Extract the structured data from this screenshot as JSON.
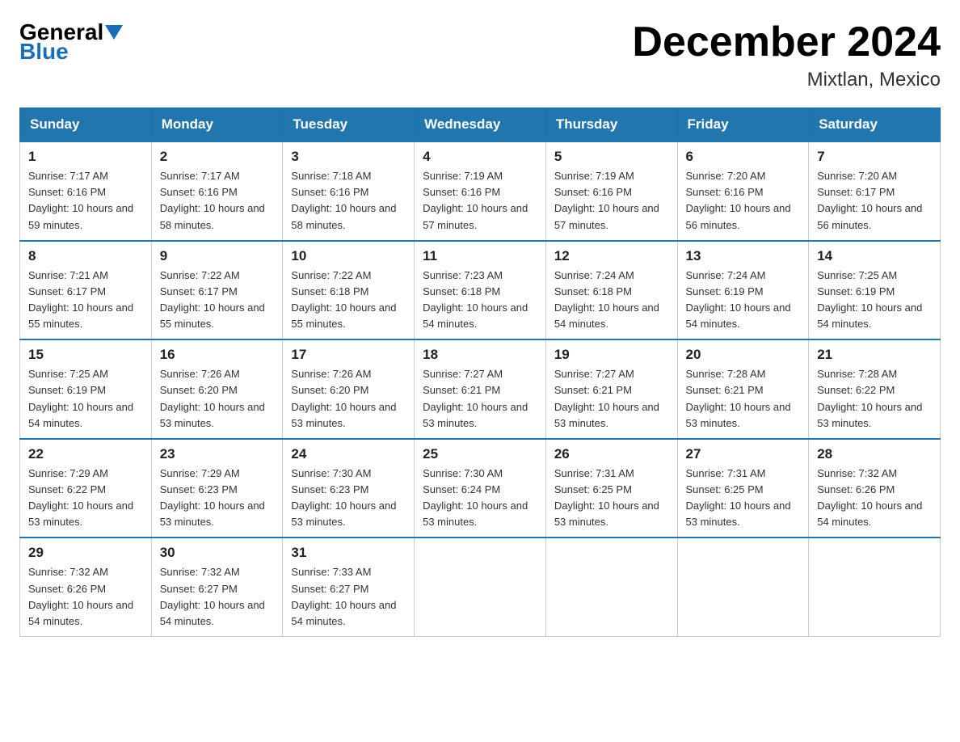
{
  "logo": {
    "general": "General",
    "blue": "Blue"
  },
  "header": {
    "title": "December 2024",
    "location": "Mixtlan, Mexico"
  },
  "days_of_week": [
    "Sunday",
    "Monday",
    "Tuesday",
    "Wednesday",
    "Thursday",
    "Friday",
    "Saturday"
  ],
  "weeks": [
    [
      {
        "day": "1",
        "sunrise": "7:17 AM",
        "sunset": "6:16 PM",
        "daylight": "10 hours and 59 minutes."
      },
      {
        "day": "2",
        "sunrise": "7:17 AM",
        "sunset": "6:16 PM",
        "daylight": "10 hours and 58 minutes."
      },
      {
        "day": "3",
        "sunrise": "7:18 AM",
        "sunset": "6:16 PM",
        "daylight": "10 hours and 58 minutes."
      },
      {
        "day": "4",
        "sunrise": "7:19 AM",
        "sunset": "6:16 PM",
        "daylight": "10 hours and 57 minutes."
      },
      {
        "day": "5",
        "sunrise": "7:19 AM",
        "sunset": "6:16 PM",
        "daylight": "10 hours and 57 minutes."
      },
      {
        "day": "6",
        "sunrise": "7:20 AM",
        "sunset": "6:16 PM",
        "daylight": "10 hours and 56 minutes."
      },
      {
        "day": "7",
        "sunrise": "7:20 AM",
        "sunset": "6:17 PM",
        "daylight": "10 hours and 56 minutes."
      }
    ],
    [
      {
        "day": "8",
        "sunrise": "7:21 AM",
        "sunset": "6:17 PM",
        "daylight": "10 hours and 55 minutes."
      },
      {
        "day": "9",
        "sunrise": "7:22 AM",
        "sunset": "6:17 PM",
        "daylight": "10 hours and 55 minutes."
      },
      {
        "day": "10",
        "sunrise": "7:22 AM",
        "sunset": "6:18 PM",
        "daylight": "10 hours and 55 minutes."
      },
      {
        "day": "11",
        "sunrise": "7:23 AM",
        "sunset": "6:18 PM",
        "daylight": "10 hours and 54 minutes."
      },
      {
        "day": "12",
        "sunrise": "7:24 AM",
        "sunset": "6:18 PM",
        "daylight": "10 hours and 54 minutes."
      },
      {
        "day": "13",
        "sunrise": "7:24 AM",
        "sunset": "6:19 PM",
        "daylight": "10 hours and 54 minutes."
      },
      {
        "day": "14",
        "sunrise": "7:25 AM",
        "sunset": "6:19 PM",
        "daylight": "10 hours and 54 minutes."
      }
    ],
    [
      {
        "day": "15",
        "sunrise": "7:25 AM",
        "sunset": "6:19 PM",
        "daylight": "10 hours and 54 minutes."
      },
      {
        "day": "16",
        "sunrise": "7:26 AM",
        "sunset": "6:20 PM",
        "daylight": "10 hours and 53 minutes."
      },
      {
        "day": "17",
        "sunrise": "7:26 AM",
        "sunset": "6:20 PM",
        "daylight": "10 hours and 53 minutes."
      },
      {
        "day": "18",
        "sunrise": "7:27 AM",
        "sunset": "6:21 PM",
        "daylight": "10 hours and 53 minutes."
      },
      {
        "day": "19",
        "sunrise": "7:27 AM",
        "sunset": "6:21 PM",
        "daylight": "10 hours and 53 minutes."
      },
      {
        "day": "20",
        "sunrise": "7:28 AM",
        "sunset": "6:21 PM",
        "daylight": "10 hours and 53 minutes."
      },
      {
        "day": "21",
        "sunrise": "7:28 AM",
        "sunset": "6:22 PM",
        "daylight": "10 hours and 53 minutes."
      }
    ],
    [
      {
        "day": "22",
        "sunrise": "7:29 AM",
        "sunset": "6:22 PM",
        "daylight": "10 hours and 53 minutes."
      },
      {
        "day": "23",
        "sunrise": "7:29 AM",
        "sunset": "6:23 PM",
        "daylight": "10 hours and 53 minutes."
      },
      {
        "day": "24",
        "sunrise": "7:30 AM",
        "sunset": "6:23 PM",
        "daylight": "10 hours and 53 minutes."
      },
      {
        "day": "25",
        "sunrise": "7:30 AM",
        "sunset": "6:24 PM",
        "daylight": "10 hours and 53 minutes."
      },
      {
        "day": "26",
        "sunrise": "7:31 AM",
        "sunset": "6:25 PM",
        "daylight": "10 hours and 53 minutes."
      },
      {
        "day": "27",
        "sunrise": "7:31 AM",
        "sunset": "6:25 PM",
        "daylight": "10 hours and 53 minutes."
      },
      {
        "day": "28",
        "sunrise": "7:32 AM",
        "sunset": "6:26 PM",
        "daylight": "10 hours and 54 minutes."
      }
    ],
    [
      {
        "day": "29",
        "sunrise": "7:32 AM",
        "sunset": "6:26 PM",
        "daylight": "10 hours and 54 minutes."
      },
      {
        "day": "30",
        "sunrise": "7:32 AM",
        "sunset": "6:27 PM",
        "daylight": "10 hours and 54 minutes."
      },
      {
        "day": "31",
        "sunrise": "7:33 AM",
        "sunset": "6:27 PM",
        "daylight": "10 hours and 54 minutes."
      },
      null,
      null,
      null,
      null
    ]
  ]
}
